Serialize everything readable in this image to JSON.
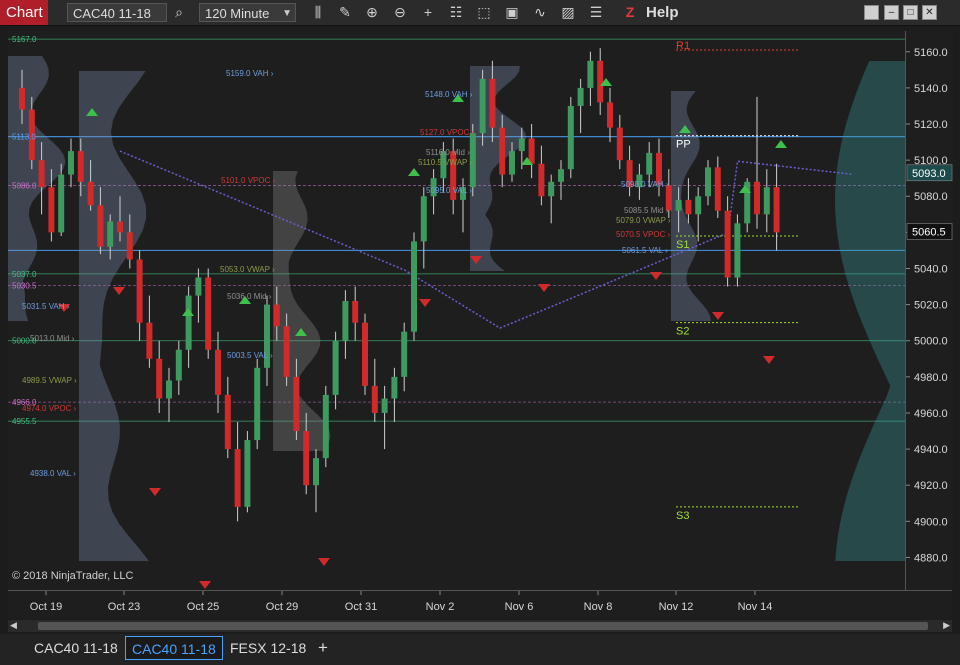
{
  "toolbar": {
    "chart_label": "Chart",
    "instrument_value": "CAC40 11-18",
    "interval_value": "120 Minute",
    "help_label": "Help",
    "icons": [
      "search-icon",
      "bar-type-icon",
      "draw-icon",
      "zoom-in-icon",
      "zoom-out-icon",
      "crosshair-icon",
      "properties-icon",
      "data-box-icon",
      "templates-icon",
      "strategies-icon",
      "indicators-icon",
      "panel-icon",
      "z-icon"
    ]
  },
  "copyright": "© 2018 NinjaTrader, LLC",
  "price_axis": {
    "ticks": [
      "5160.0",
      "5140.0",
      "5120.0",
      "5100.0",
      "5080.0",
      "5060.0",
      "5040.0",
      "5020.0",
      "5000.0",
      "4980.0",
      "4960.0",
      "4940.0",
      "4920.0",
      "4900.0",
      "4880.0"
    ],
    "last_price": "5060.5",
    "marker_price": "5093.0"
  },
  "date_axis": {
    "labels": [
      "Oct 19",
      "Oct 23",
      "Oct 25",
      "Oct 29",
      "Oct 31",
      "Nov 2",
      "Nov 6",
      "Nov 8",
      "Nov 12",
      "Nov 14"
    ]
  },
  "pivots": {
    "r1": "R1",
    "pp": "PP",
    "s1": "S1",
    "s2": "S2",
    "s3": "S3"
  },
  "level_labels": [
    {
      "text": "5167.0",
      "price": 5167,
      "color": "#3fbf7f"
    },
    {
      "text": "5113.0",
      "price": 5113,
      "color": "#4aa3ff"
    },
    {
      "text": "5086.0",
      "price": 5086,
      "color": "#d070d0"
    },
    {
      "text": "5037.0",
      "price": 5037,
      "color": "#3fbf7f"
    },
    {
      "text": "5030.5",
      "price": 5030.5,
      "color": "#d070d0"
    },
    {
      "text": "5000.0",
      "price": 5000,
      "color": "#3fbf7f"
    },
    {
      "text": "4966.0",
      "price": 4966,
      "color": "#d070d0"
    },
    {
      "text": "4955.5",
      "price": 4955.5,
      "color": "#3fbf7f"
    }
  ],
  "profile_labels": [
    {
      "text": "5159.0 VAH",
      "color": "#6e9ee0"
    },
    {
      "text": "5101.0 VPOC",
      "color": "#d03838"
    },
    {
      "text": "5031.5 VAH",
      "color": "#6e9ee0"
    },
    {
      "text": "5013.0 Mid",
      "color": "#909090"
    },
    {
      "text": "4989.5 VWAP",
      "color": "#8e9a4c"
    },
    {
      "text": "4974.0 VPOC",
      "color": "#d03838"
    },
    {
      "text": "4938.0 VAL",
      "color": "#6e9ee0"
    },
    {
      "text": "5053.0 VWAP",
      "color": "#8e9a4c"
    },
    {
      "text": "5036.0 Mid",
      "color": "#909090"
    },
    {
      "text": "5003.5 VAL",
      "color": "#6e9ee0"
    },
    {
      "text": "5148.0 VAH",
      "color": "#6e9ee0"
    },
    {
      "text": "5127.0 VPOC",
      "color": "#d03838"
    },
    {
      "text": "5116.0 Mid",
      "color": "#909090"
    },
    {
      "text": "5110.5 VWAP",
      "color": "#8e9a4c"
    },
    {
      "text": "5095.0 VAL",
      "color": "#6e9ee0"
    },
    {
      "text": "5098.0 VAH",
      "color": "#6e9ee0"
    },
    {
      "text": "5085.5 Mid",
      "color": "#909090"
    },
    {
      "text": "5079.0 VWAP",
      "color": "#8e9a4c"
    },
    {
      "text": "5070.5 VPOC",
      "color": "#d03838"
    },
    {
      "text": "5061.5 VAL",
      "color": "#6e9ee0"
    }
  ],
  "tabs": [
    "CAC40 11-18",
    "CAC40 11-18",
    "FESX 12-18"
  ],
  "active_tab": 1,
  "add_tab": "+",
  "colors": {
    "up": "#3f9a5f",
    "down": "#d02a2a",
    "accent": "#4aa3ff",
    "toolbar_red": "#b01e2a"
  },
  "chart_data": {
    "type": "candlestick",
    "ylim": [
      4880,
      5170
    ],
    "x_labels": [
      "Oct 19",
      "Oct 23",
      "Oct 25",
      "Oct 29",
      "Oct 31",
      "Nov 2",
      "Nov 6",
      "Nov 8",
      "Nov 12",
      "Nov 14"
    ],
    "candles": [
      [
        5140,
        5150,
        5120,
        5128
      ],
      [
        5128,
        5135,
        5095,
        5100
      ],
      [
        5100,
        5110,
        5070,
        5085
      ],
      [
        5085,
        5095,
        5055,
        5060
      ],
      [
        5060,
        5098,
        5058,
        5092
      ],
      [
        5092,
        5112,
        5085,
        5105
      ],
      [
        5105,
        5112,
        5080,
        5088
      ],
      [
        5088,
        5100,
        5072,
        5075
      ],
      [
        5075,
        5085,
        5048,
        5052
      ],
      [
        5052,
        5070,
        5045,
        5066
      ],
      [
        5066,
        5080,
        5055,
        5060
      ],
      [
        5060,
        5070,
        5040,
        5045
      ],
      [
        5045,
        5050,
        5000,
        5010
      ],
      [
        5010,
        5025,
        4985,
        4990
      ],
      [
        4990,
        5000,
        4960,
        4968
      ],
      [
        4968,
        4985,
        4955,
        4978
      ],
      [
        4978,
        5000,
        4970,
        4995
      ],
      [
        4995,
        5030,
        4985,
        5025
      ],
      [
        5025,
        5040,
        5010,
        5035
      ],
      [
        5035,
        5040,
        4990,
        4995
      ],
      [
        4995,
        5005,
        4960,
        4970
      ],
      [
        4970,
        4980,
        4935,
        4940
      ],
      [
        4940,
        4955,
        4900,
        4908
      ],
      [
        4908,
        4950,
        4905,
        4945
      ],
      [
        4945,
        4990,
        4940,
        4985
      ],
      [
        4985,
        5025,
        4975,
        5020
      ],
      [
        5020,
        5030,
        5000,
        5008
      ],
      [
        5008,
        5015,
        4975,
        4980
      ],
      [
        4980,
        4990,
        4945,
        4950
      ],
      [
        4950,
        4960,
        4915,
        4920
      ],
      [
        4920,
        4940,
        4905,
        4935
      ],
      [
        4935,
        4975,
        4930,
        4970
      ],
      [
        4970,
        5005,
        4962,
        5000
      ],
      [
        5000,
        5028,
        4990,
        5022
      ],
      [
        5022,
        5030,
        5000,
        5010
      ],
      [
        5010,
        5015,
        4970,
        4975
      ],
      [
        4975,
        4990,
        4955,
        4960
      ],
      [
        4960,
        4975,
        4940,
        4968
      ],
      [
        4968,
        4985,
        4955,
        4980
      ],
      [
        4980,
        5010,
        4972,
        5005
      ],
      [
        5005,
        5060,
        5000,
        5055
      ],
      [
        5055,
        5085,
        5040,
        5080
      ],
      [
        5080,
        5095,
        5070,
        5090
      ],
      [
        5090,
        5110,
        5082,
        5105
      ],
      [
        5105,
        5112,
        5070,
        5078
      ],
      [
        5078,
        5090,
        5060,
        5085
      ],
      [
        5085,
        5120,
        5080,
        5115
      ],
      [
        5115,
        5150,
        5108,
        5145
      ],
      [
        5145,
        5155,
        5110,
        5118
      ],
      [
        5118,
        5125,
        5085,
        5092
      ],
      [
        5092,
        5110,
        5088,
        5105
      ],
      [
        5105,
        5118,
        5095,
        5112
      ],
      [
        5112,
        5120,
        5090,
        5098
      ],
      [
        5098,
        5108,
        5075,
        5080
      ],
      [
        5080,
        5092,
        5065,
        5088
      ],
      [
        5088,
        5100,
        5078,
        5095
      ],
      [
        5095,
        5135,
        5090,
        5130
      ],
      [
        5130,
        5145,
        5115,
        5140
      ],
      [
        5140,
        5160,
        5130,
        5155
      ],
      [
        5155,
        5162,
        5125,
        5132
      ],
      [
        5132,
        5140,
        5110,
        5118
      ],
      [
        5118,
        5125,
        5095,
        5100
      ],
      [
        5100,
        5108,
        5080,
        5085
      ],
      [
        5085,
        5098,
        5078,
        5092
      ],
      [
        5092,
        5110,
        5085,
        5104
      ],
      [
        5104,
        5112,
        5080,
        5086
      ],
      [
        5086,
        5095,
        5068,
        5072
      ],
      [
        5072,
        5085,
        5060,
        5078
      ],
      [
        5078,
        5090,
        5065,
        5070
      ],
      [
        5070,
        5085,
        5055,
        5080
      ],
      [
        5080,
        5100,
        5075,
        5096
      ],
      [
        5096,
        5102,
        5068,
        5072
      ],
      [
        5072,
        5080,
        5030,
        5035
      ],
      [
        5035,
        5070,
        5030,
        5065
      ],
      [
        5065,
        5090,
        5060,
        5088
      ],
      [
        5088,
        5135,
        5062,
        5070
      ],
      [
        5070,
        5095,
        5060,
        5085
      ],
      [
        5085,
        5098,
        5050,
        5060
      ]
    ]
  }
}
